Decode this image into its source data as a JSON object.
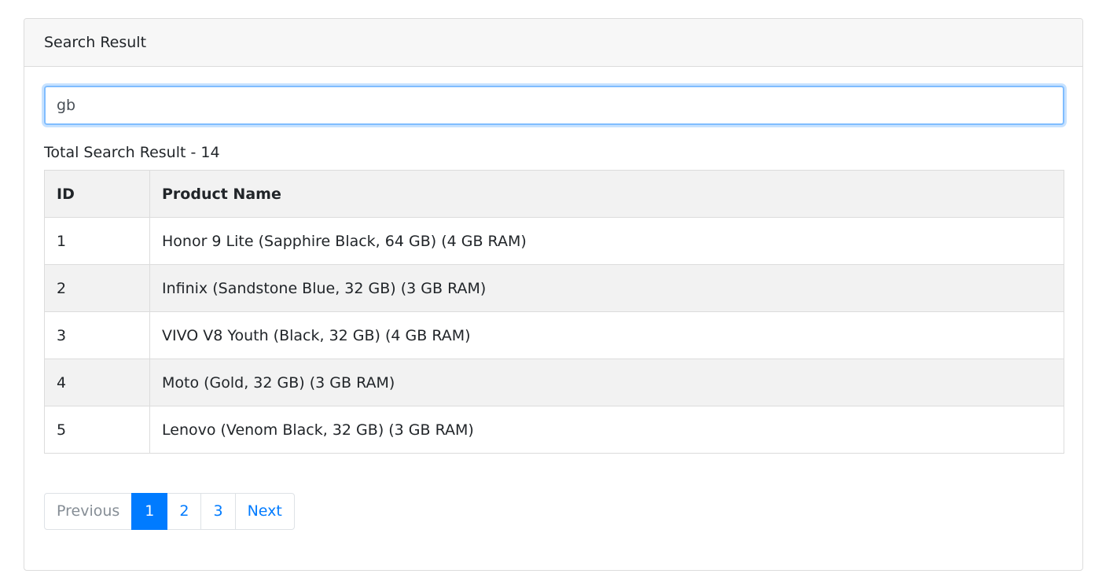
{
  "card": {
    "title": "Search Result"
  },
  "search": {
    "value": "gb"
  },
  "summary": {
    "total_text": "Total Search Result - 14"
  },
  "table": {
    "headers": {
      "id": "ID",
      "name": "Product Name"
    },
    "rows": [
      {
        "id": "1",
        "name": "Honor 9 Lite (Sapphire Black, 64 GB) (4 GB RAM)"
      },
      {
        "id": "2",
        "name": "Infinix (Sandstone Blue, 32 GB) (3 GB RAM)"
      },
      {
        "id": "3",
        "name": "VIVO V8 Youth (Black, 32 GB) (4 GB RAM)"
      },
      {
        "id": "4",
        "name": "Moto (Gold, 32 GB) (3 GB RAM)"
      },
      {
        "id": "5",
        "name": "Lenovo (Venom Black, 32 GB) (3 GB RAM)"
      }
    ]
  },
  "pagination": {
    "previous": "Previous",
    "pages": [
      "1",
      "2",
      "3"
    ],
    "next": "Next",
    "active_page": "1"
  },
  "colors": {
    "primary": "#007bff",
    "header_bg": "#f7f7f7",
    "stripe_bg": "#f2f2f2",
    "border": "#dcdcdc"
  }
}
